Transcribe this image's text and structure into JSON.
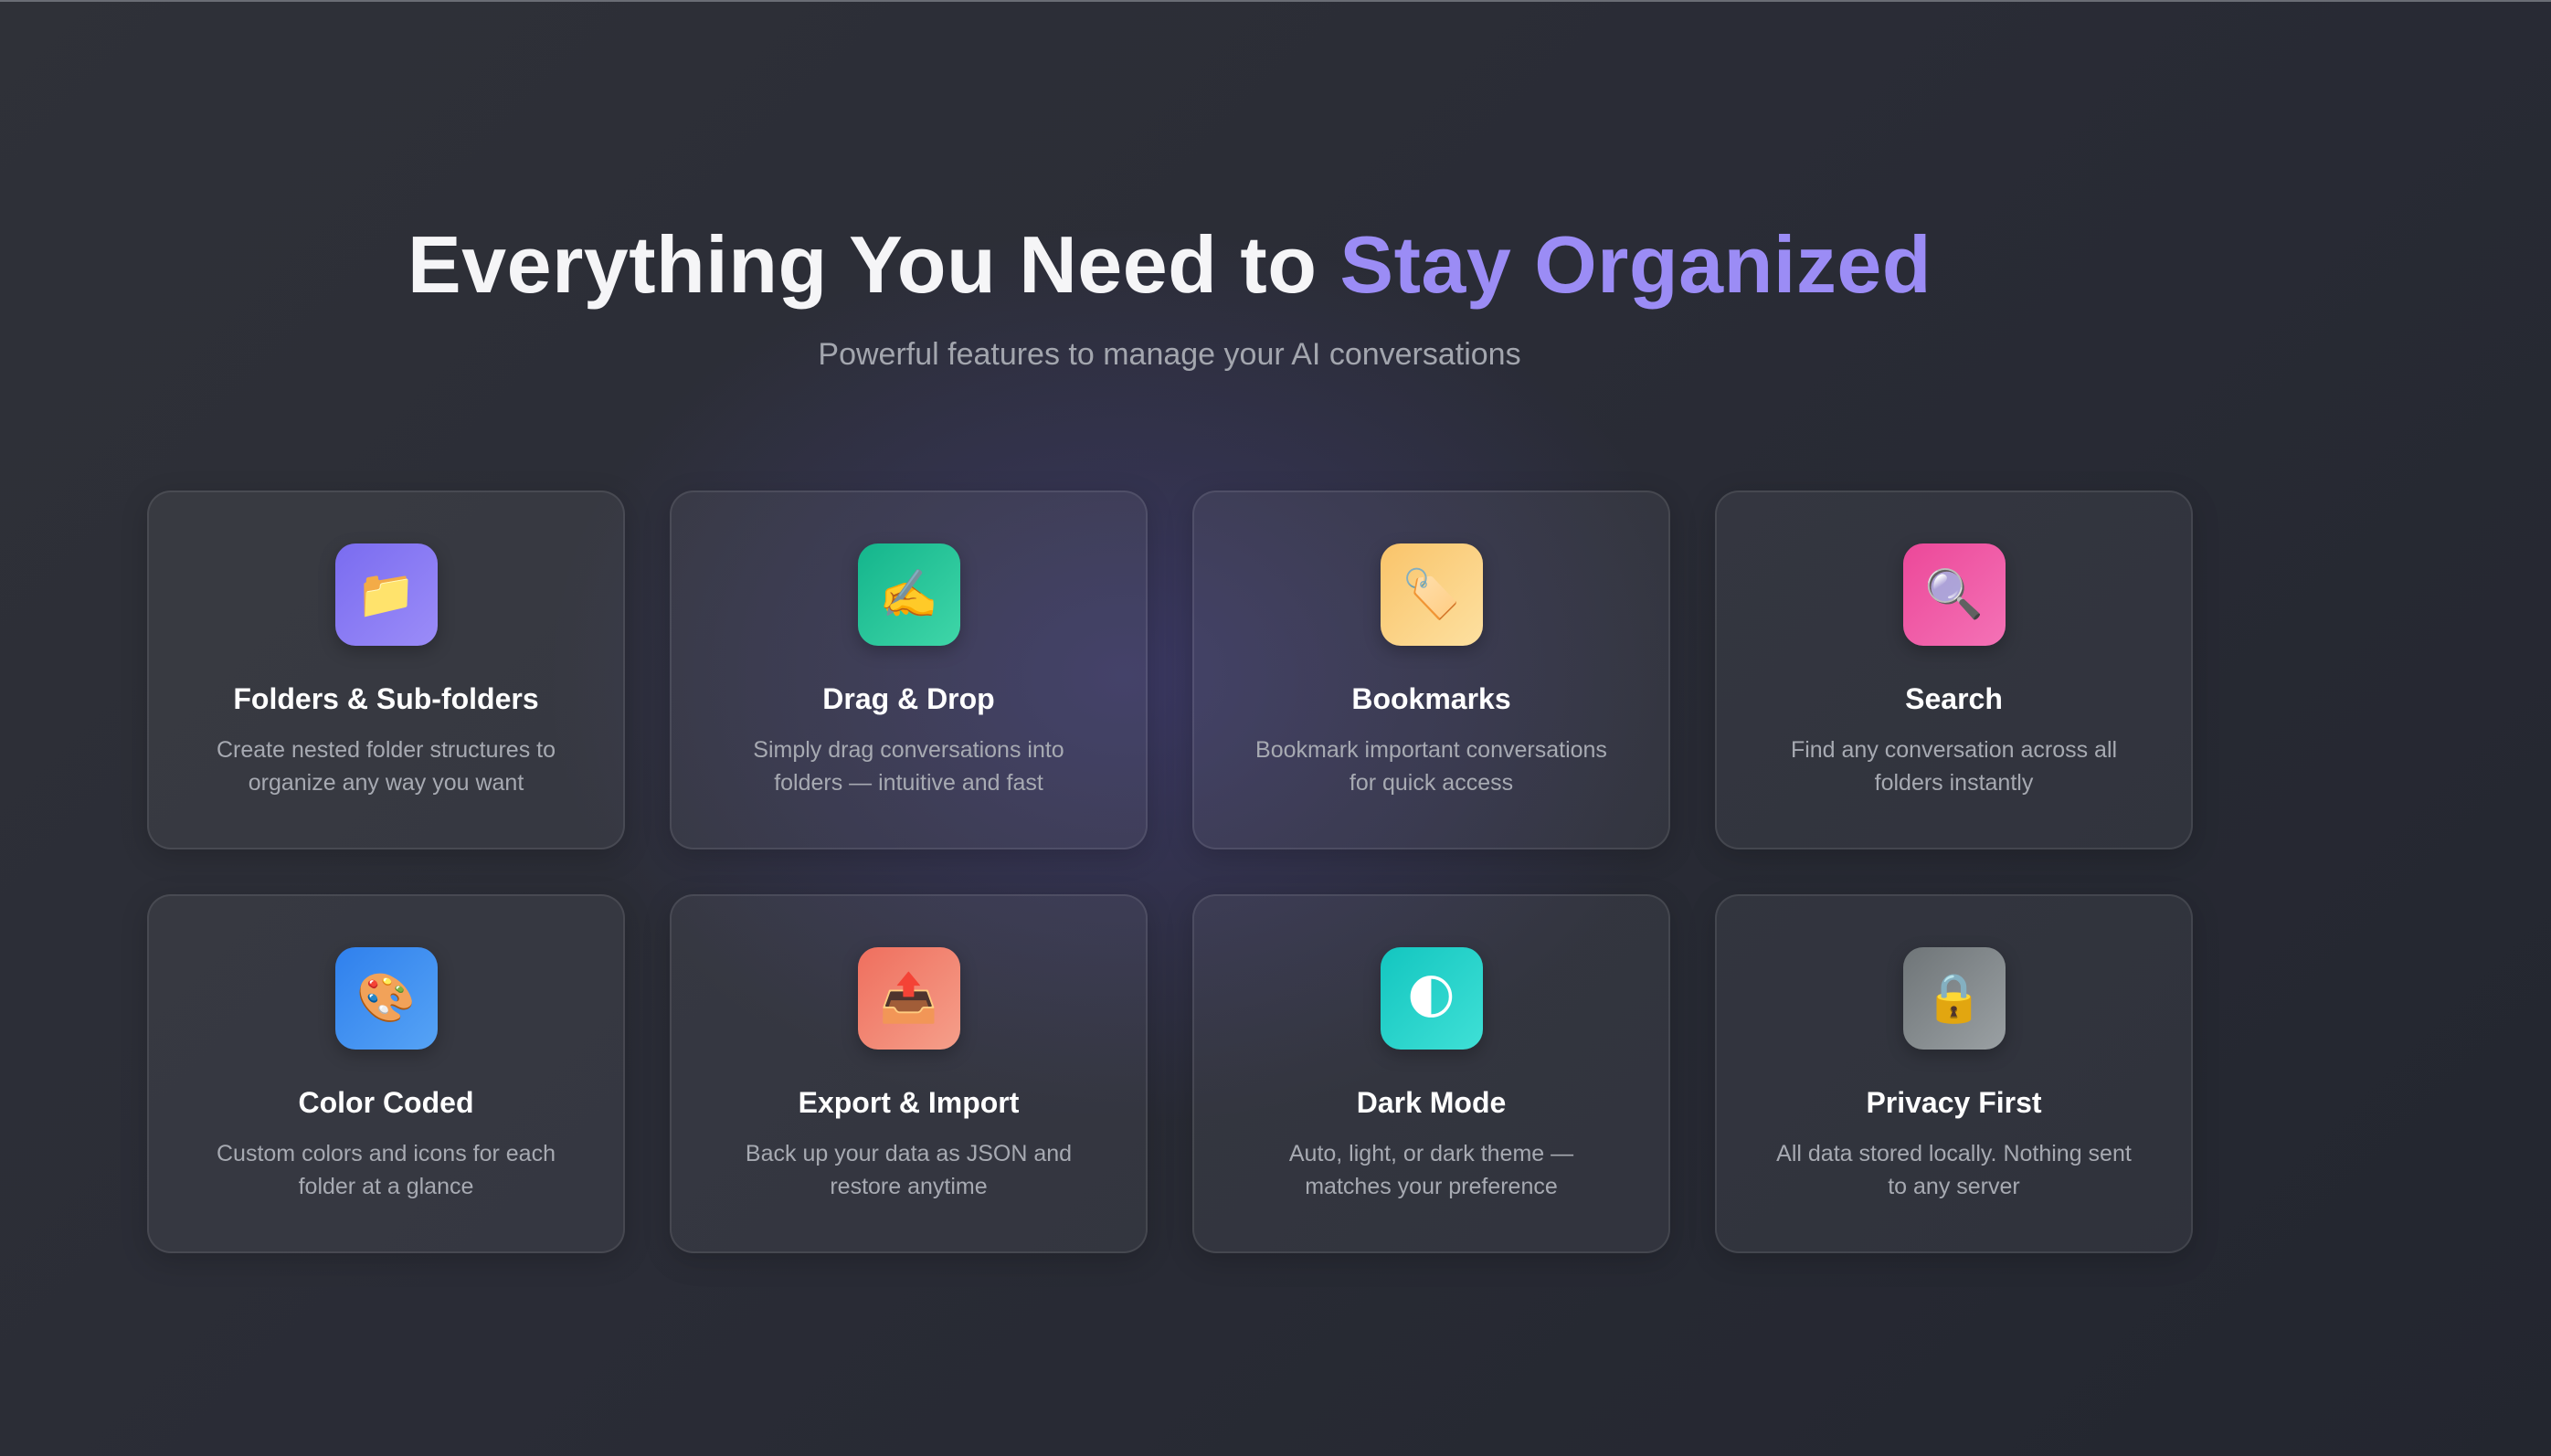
{
  "hero": {
    "title_main": "Everything You Need to ",
    "title_accent": "Stay Organized",
    "subtitle": "Powerful features to manage your AI conversations"
  },
  "features": [
    {
      "title": "Folders & Sub-folders",
      "description": "Create nested folder structures to organize any way you want",
      "icon": "folder-icon",
      "glyph": "📁",
      "gradient": [
        "#7a6cf0",
        "#9b8cf8"
      ]
    },
    {
      "title": "Drag & Drop",
      "description": "Simply drag conversations into folders — intuitive and fast",
      "icon": "writing-hand-icon",
      "glyph": "✍️",
      "gradient": [
        "#14b58c",
        "#3fd6a8"
      ]
    },
    {
      "title": "Bookmarks",
      "description": "Bookmark important conversations for quick access",
      "icon": "bookmark-tag-icon",
      "glyph": "🏷️",
      "gradient": [
        "#f9c46a",
        "#fde0a0"
      ]
    },
    {
      "title": "Search",
      "description": "Find any conversation across all folders instantly",
      "icon": "magnifier-icon",
      "glyph": "🔍",
      "gradient": [
        "#ec4899",
        "#f472b6"
      ]
    },
    {
      "title": "Color Coded",
      "description": "Custom colors and icons for each folder at a glance",
      "icon": "palette-icon",
      "glyph": "🎨",
      "gradient": [
        "#2f80ed",
        "#56a3f5"
      ]
    },
    {
      "title": "Export & Import",
      "description": "Back up your data as JSON and restore anytime",
      "icon": "outbox-tray-icon",
      "glyph": "📤",
      "gradient": [
        "#ef6f5e",
        "#f59f8a"
      ]
    },
    {
      "title": "Dark Mode",
      "description": "Auto, light, or dark theme — matches your preference",
      "icon": "half-moon-icon",
      "glyph": "🌓",
      "gradient": [
        "#13c6c0",
        "#3fe0d6"
      ]
    },
    {
      "title": "Privacy First",
      "description": "All data stored locally. Nothing sent to any server",
      "icon": "padlock-icon",
      "glyph": "🔒",
      "gradient": [
        "#6f7578",
        "#9aa0a3"
      ]
    }
  ],
  "colors": {
    "accent": "#9b8cf5",
    "background": "#2a2c36",
    "card_border": "rgba(255,255,255,0.09)"
  }
}
